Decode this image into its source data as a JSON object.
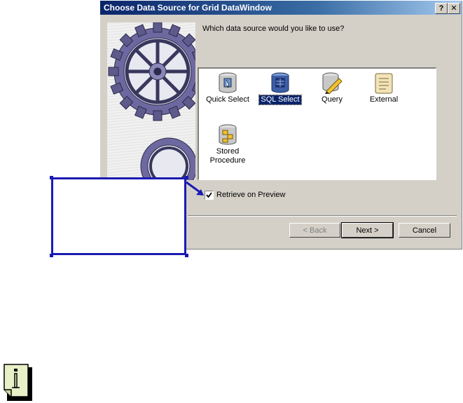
{
  "dialog": {
    "title": "Choose Data Source for Grid DataWindow",
    "help_button": "?",
    "close_button": "✕",
    "prompt": "Which data source would you like to use?"
  },
  "data_sources": [
    {
      "label": "Quick Select",
      "icon": "quick-select-icon",
      "selected": false
    },
    {
      "label": "SQL Select",
      "icon": "sql-select-icon",
      "selected": true
    },
    {
      "label": "Query",
      "icon": "query-icon",
      "selected": false
    },
    {
      "label": "External",
      "icon": "external-icon",
      "selected": false
    },
    {
      "label": "Stored\nProcedure",
      "icon": "stored-procedure-icon",
      "selected": false
    }
  ],
  "retrieve_checkbox": {
    "label": "Retrieve on Preview",
    "checked": true
  },
  "buttons": {
    "back": "< Back",
    "next": "Next >",
    "cancel": "Cancel"
  },
  "colors": {
    "titlebar": "#0a246a",
    "dialog_bg": "#d4d0c8",
    "callout_border": "#1a1ab4",
    "selection": "#0a246a"
  }
}
